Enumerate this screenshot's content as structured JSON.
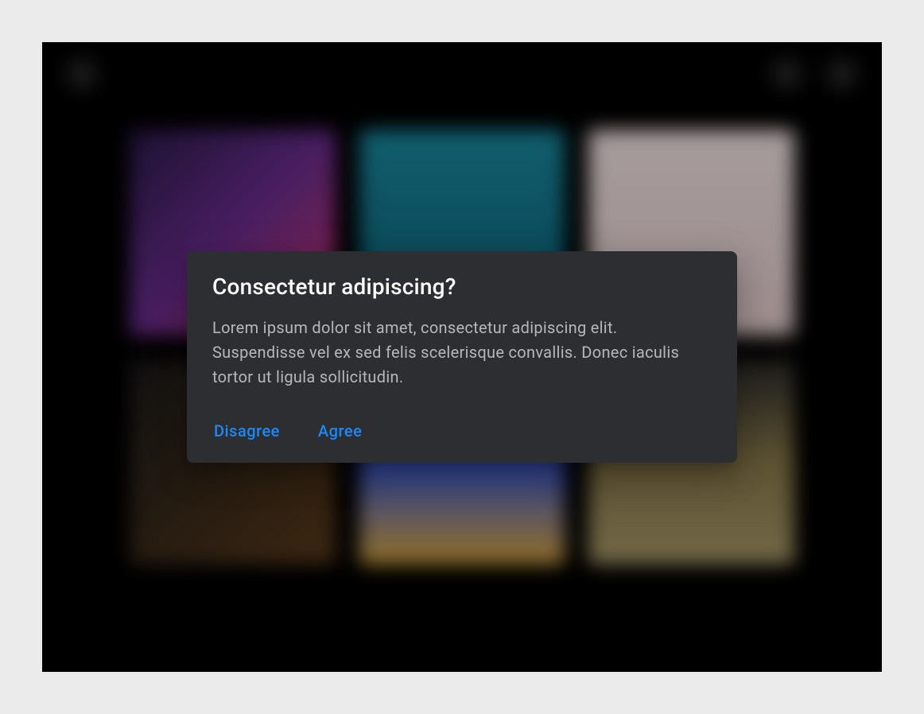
{
  "dialog": {
    "title": "Consectetur adipiscing?",
    "body": "Lorem ipsum dolor sit amet, consectetur adipiscing elit. Suspendisse vel ex sed felis scelerisque convallis. Donec iaculis tortor ut ligula sollicitudin.",
    "actions": {
      "disagree": "Disagree",
      "agree": "Agree"
    }
  },
  "colors": {
    "accent": "#1e88f7",
    "dialog_bg": "#2d2e31",
    "page_bg": "#ebebeb",
    "viewport_bg": "#000000"
  }
}
